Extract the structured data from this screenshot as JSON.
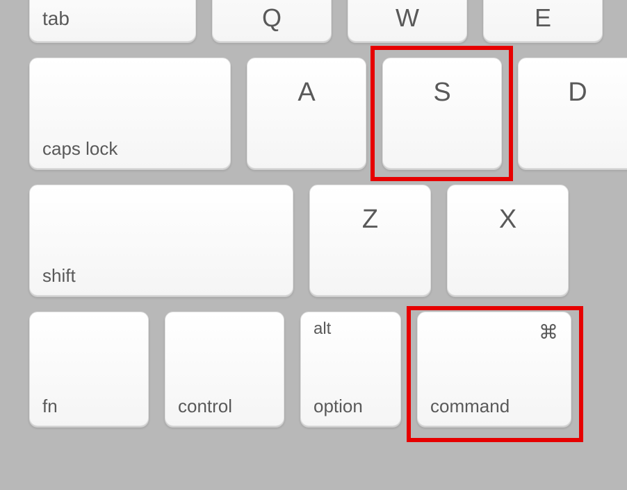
{
  "keys": {
    "tab": "tab",
    "q": "Q",
    "w": "W",
    "e": "E",
    "caps_lock": "caps lock",
    "a": "A",
    "s": "S",
    "d": "D",
    "shift": "shift",
    "z": "Z",
    "x": "X",
    "fn": "fn",
    "control": "control",
    "alt": "alt",
    "option": "option",
    "command": "command",
    "cmd_symbol": "⌘"
  },
  "highlighted": [
    "s",
    "command"
  ]
}
